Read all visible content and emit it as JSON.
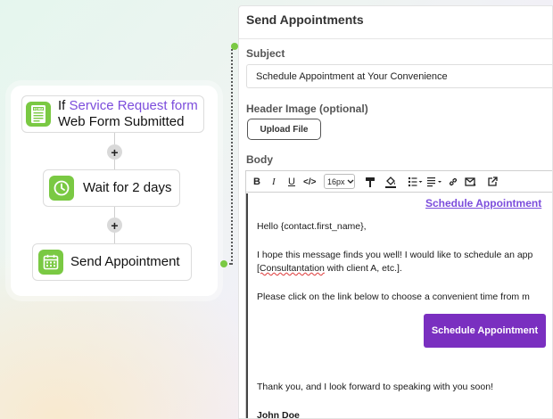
{
  "workflow": {
    "trigger": {
      "prefix": "If ",
      "highlight": "Service Request form",
      "line2": "Web Form Submitted",
      "icon": "form-icon"
    },
    "wait": {
      "label": "Wait for 2 days",
      "icon": "clock-icon"
    },
    "action": {
      "label": "Send Appointment",
      "icon": "calendar-icon"
    },
    "add_symbol": "+"
  },
  "panel": {
    "title": "Send Appointments",
    "subject_label": "Subject",
    "subject_value": "Schedule Appointment at Your Convenience",
    "header_image_label": "Header Image (optional)",
    "upload_label": "Upload File",
    "body_label": "Body"
  },
  "toolbar": {
    "bold": "B",
    "italic": "I",
    "underline": "U",
    "code": "</>",
    "font_size": "16px"
  },
  "body": {
    "link_text": "Schedule Appointment",
    "greeting": "Hello {contact.first_name},",
    "para1_line1": "I hope this message finds you well! I would like to schedule an app",
    "para1_line2_marked": "[Consultantation",
    "para1_line2_rest": " with client A, etc.].",
    "para2": "Please click on the link below to choose a convenient time from m",
    "button_label": "Schedule Appointment",
    "closing": "Thank you, and I look forward to speaking with you soon!",
    "signature": "John Doe"
  },
  "colors": {
    "accent": "#7c4ddc",
    "button": "#7a2fc0",
    "node_icon": "#7ac943"
  }
}
